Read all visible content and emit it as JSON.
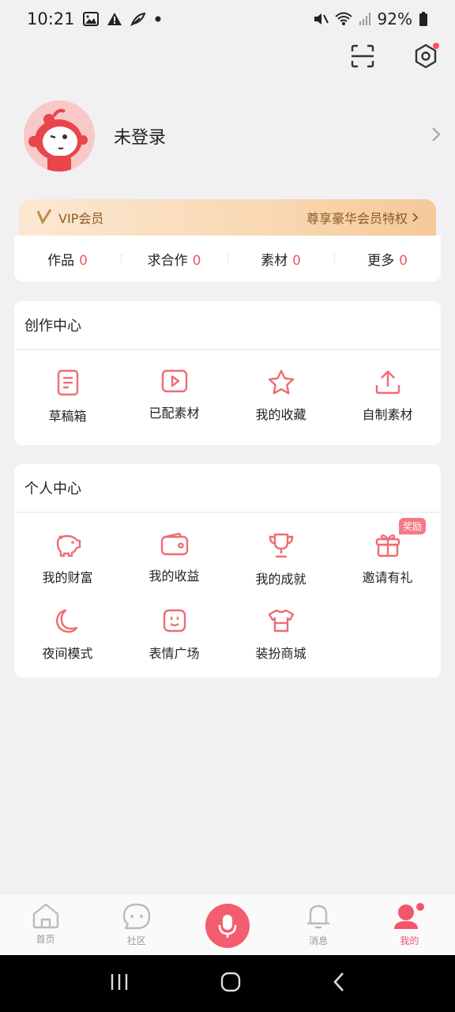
{
  "status_bar": {
    "time": "10:21",
    "battery": "92%",
    "icons": [
      "image-icon",
      "warning-icon",
      "leaf-icon",
      "dot-icon",
      "mute-icon",
      "wifi-icon",
      "signal-icon",
      "battery-icon"
    ]
  },
  "top_actions": {
    "scan_icon": "scan-icon",
    "settings_icon": "settings-icon"
  },
  "profile": {
    "name": "未登录"
  },
  "vip": {
    "label": "VIP会员",
    "promo": "尊享豪华会员特权"
  },
  "stats": [
    {
      "label": "作品",
      "count": "0"
    },
    {
      "label": "求合作",
      "count": "0"
    },
    {
      "label": "素材",
      "count": "0"
    },
    {
      "label": "更多",
      "count": "0"
    }
  ],
  "creation_center": {
    "title": "创作中心",
    "items": [
      {
        "label": "草稿箱",
        "icon": "document-icon"
      },
      {
        "label": "已配素材",
        "icon": "play-video-icon"
      },
      {
        "label": "我的收藏",
        "icon": "star-icon"
      },
      {
        "label": "自制素材",
        "icon": "upload-icon"
      }
    ]
  },
  "personal_center": {
    "title": "个人中心",
    "items": [
      {
        "label": "我的财富",
        "icon": "piggy-bank-icon"
      },
      {
        "label": "我的收益",
        "icon": "wallet-icon"
      },
      {
        "label": "我的成就",
        "icon": "trophy-icon"
      },
      {
        "label": "邀请有礼",
        "icon": "gift-icon",
        "badge": "奖励"
      },
      {
        "label": "夜间模式",
        "icon": "moon-icon"
      },
      {
        "label": "表情广场",
        "icon": "emoji-face-icon"
      },
      {
        "label": "装扮商城",
        "icon": "shirt-icon"
      }
    ]
  },
  "bottom_nav": [
    {
      "label": "首页",
      "icon": "home-icon"
    },
    {
      "label": "社区",
      "icon": "chat-icon"
    },
    {
      "label": "",
      "icon": "mic-icon"
    },
    {
      "label": "消息",
      "icon": "bell-icon"
    },
    {
      "label": "我的",
      "icon": "profile-icon",
      "active": true
    }
  ],
  "colors": {
    "accent": "#f2566b",
    "icon_stroke": "#f06b73",
    "background": "#f1f1f4"
  }
}
